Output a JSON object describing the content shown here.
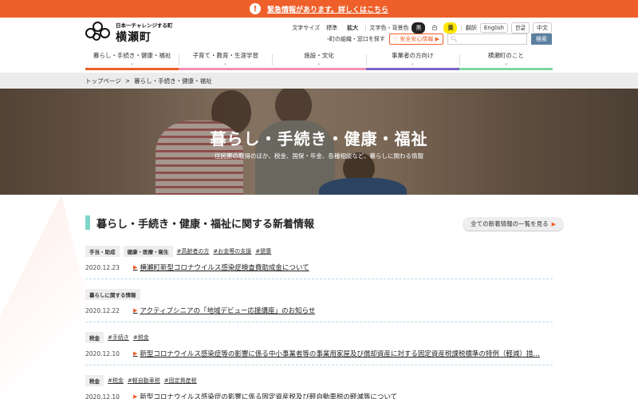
{
  "alert": {
    "text": "緊急情報があります。詳しくはこちら",
    "icon": "exclamation-icon"
  },
  "logo": {
    "sub": "日本一チャレンジする町",
    "main": "横瀬町"
  },
  "utility": {
    "font_size_label": "文字サイズ",
    "font_standard": "標準",
    "font_large": "拡大",
    "color_label": "文字色・背景色",
    "color_black": "黒",
    "color_white": "白",
    "color_yellow": "黄",
    "translate_label": "翻訳",
    "lang_en": "English",
    "lang_ko": "한글",
    "lang_zh": "中文",
    "org_link": "町の組織・窓口を探す",
    "anzen": "安全安心情報",
    "search_button": "検索"
  },
  "gnav": [
    {
      "label": "暮らし・手続き・健康・福祉",
      "color": "#ee5f2a"
    },
    {
      "label": "子育て・教育・生涯学習",
      "color": "#f18fb4"
    },
    {
      "label": "施設・文化",
      "color": "#f18fb4"
    },
    {
      "label": "事業者の方向け",
      "color": "#7a64c8"
    },
    {
      "label": "横瀬町のこと",
      "color": "#7fd6a0"
    }
  ],
  "breadcrumb": {
    "home": "トップページ",
    "sep": ">",
    "current": "暮らし・手続き・健康・福祉"
  },
  "hero": {
    "title": "暮らし・手続き・健康・福祉",
    "subtitle": "住民票の取得のほか、税金、国保・年金、各種相談など、暮らしに関わる情報"
  },
  "news": {
    "title": "暮らし・手続き・健康・福祉に関する新着情報",
    "all_button": "全ての新着情報の一覧を見る",
    "items": [
      {
        "cats": [
          "手当・助成",
          "健康・医療・衛生"
        ],
        "tags": [
          "#高齢者の方",
          "#お金等の支援",
          "#健康"
        ],
        "date": "2020.12.23",
        "title": "横瀬町新型コロナウイルス感染症検査費助成金について"
      },
      {
        "cats": [
          "暮らしに関する情報"
        ],
        "tags": [],
        "date": "2020.12.22",
        "title": "アクティブシニアの「地域デビュー応援講座」のお知らせ"
      },
      {
        "cats": [
          "税金"
        ],
        "tags": [
          "#手続き",
          "#税金"
        ],
        "date": "2020.12.10",
        "title": "新型コロナウイルス感染症等の影響に係る中小事業者等の事業用家屋及び償却資産に対する固定資産税課税標準の特例（軽減）措…"
      },
      {
        "cats": [
          "税金"
        ],
        "tags": [
          "#税金",
          "#軽自動車税",
          "#固定資産税"
        ],
        "date": "2020.12.10",
        "title": "新型コロナウイルス感染症の影響に係る固定資産税及び軽自動車税の軽減等について"
      }
    ]
  }
}
